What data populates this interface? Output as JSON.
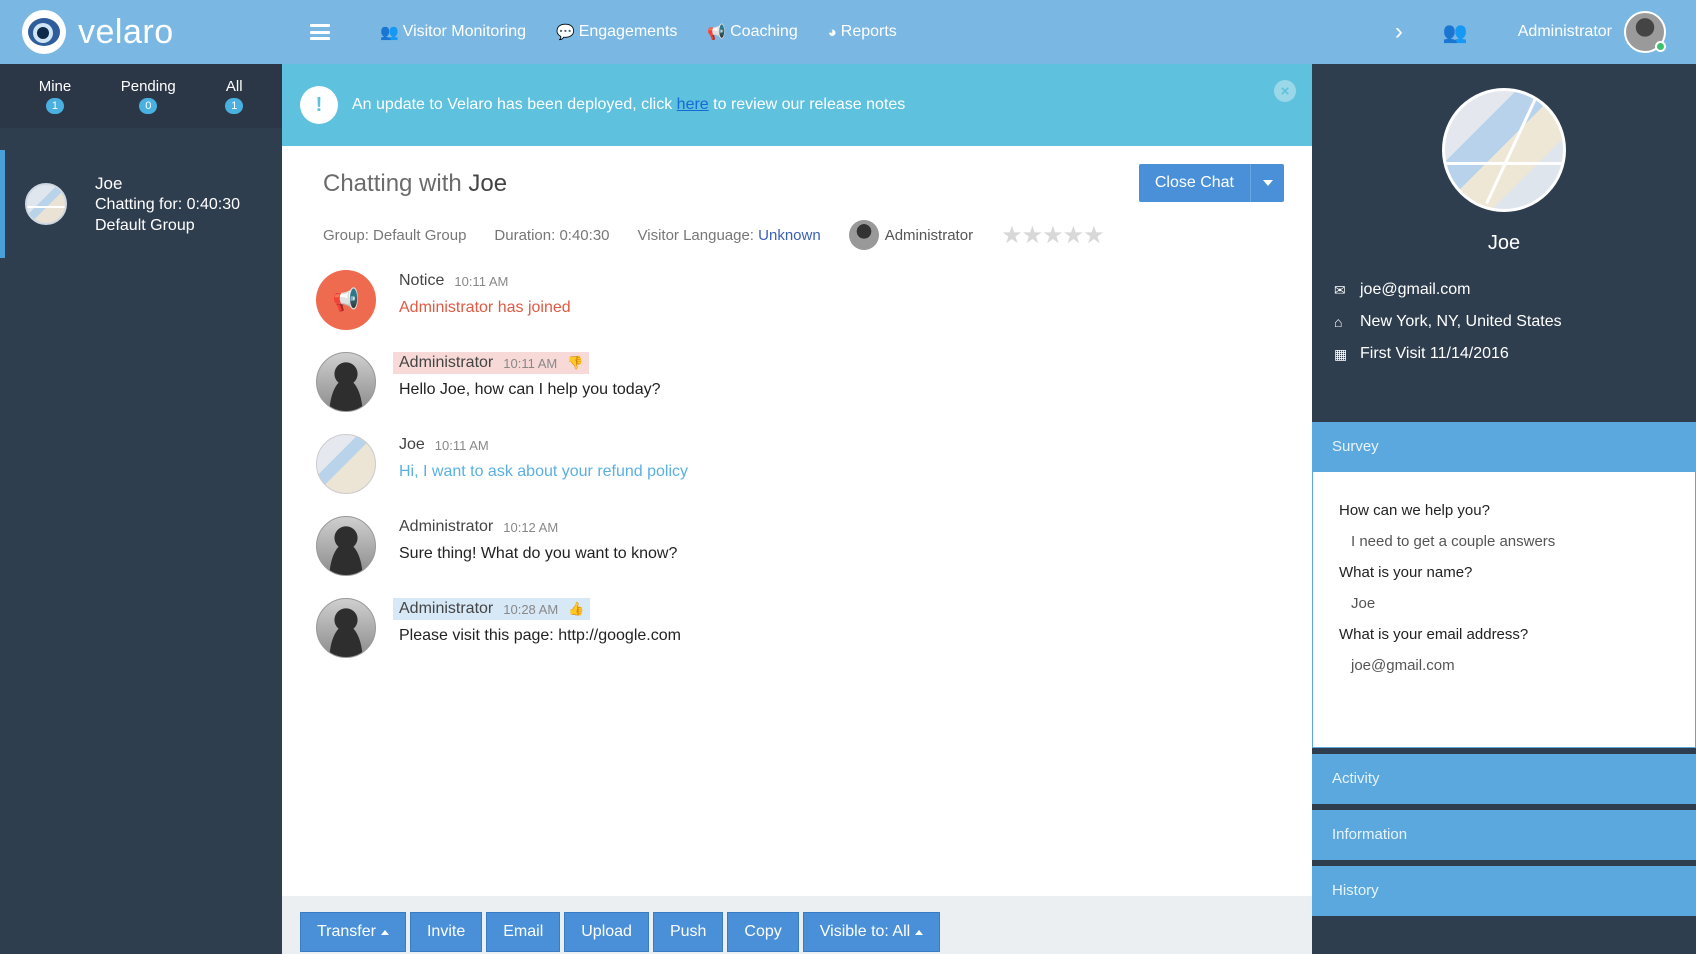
{
  "brand": {
    "name": "velaro"
  },
  "nav": {
    "links": [
      {
        "label": "Visitor Monitoring",
        "icon": "users-icon"
      },
      {
        "label": "Engagements",
        "icon": "chat-bubble-icon"
      },
      {
        "label": "Coaching",
        "icon": "megaphone-icon"
      },
      {
        "label": "Reports",
        "icon": "pie-chart-icon"
      }
    ],
    "user_name": "Administrator"
  },
  "filters": [
    {
      "label": "Mine",
      "count": "1"
    },
    {
      "label": "Pending",
      "count": "0"
    },
    {
      "label": "All",
      "count": "1"
    }
  ],
  "chat_list": [
    {
      "name": "Joe",
      "duration": "Chatting for: 0:40:30",
      "group": "Default Group"
    }
  ],
  "banner": {
    "text_before": "An update to Velaro has been deployed, click ",
    "link": "here",
    "text_after": " to review our release notes"
  },
  "chat": {
    "title_prefix": "Chatting with ",
    "visitor": "Joe",
    "close_label": "Close Chat",
    "group": "Group: Default Group",
    "duration": "Duration: 0:40:30",
    "lang_label": "Visitor Language: ",
    "lang_value": "Unknown",
    "agent": "Administrator",
    "stars": "★★★★★"
  },
  "messages": [
    {
      "author": "Notice",
      "time": "10:11 AM",
      "text": "Administrator has joined"
    },
    {
      "author": "Administrator",
      "time": "10:11 AM",
      "text": "Hello Joe, how can I help you today?"
    },
    {
      "author": "Joe",
      "time": "10:11 AM",
      "text": "Hi, I want to ask about your refund policy"
    },
    {
      "author": "Administrator",
      "time": "10:12 AM",
      "text": "Sure thing! What do you want to know?"
    },
    {
      "author": "Administrator",
      "time": "10:28 AM",
      "text": "Please visit this page: http://google.com"
    }
  ],
  "toolbar": {
    "transfer": "Transfer",
    "invite": "Invite",
    "email": "Email",
    "upload": "Upload",
    "push": "Push",
    "copy": "Copy",
    "visible": "Visible to: All"
  },
  "profile": {
    "name": "Joe",
    "email": "joe@gmail.com",
    "location": "New York, NY, United States",
    "first_visit": "First Visit 11/14/2016"
  },
  "sections": {
    "survey": "Survey",
    "activity": "Activity",
    "information": "Information",
    "history": "History"
  },
  "survey": [
    {
      "q": "How can we help you?",
      "a": "I need to get a couple answers"
    },
    {
      "q": "What is your name?",
      "a": "Joe"
    },
    {
      "q": "What is your email address?",
      "a": "joe@gmail.com"
    }
  ],
  "colors": {
    "topbar": "#7ab8e3",
    "sidebar": "#2f3e4e",
    "banner": "#5ec1dd",
    "button": "#4a90d9",
    "notice": "#ef6b50"
  }
}
